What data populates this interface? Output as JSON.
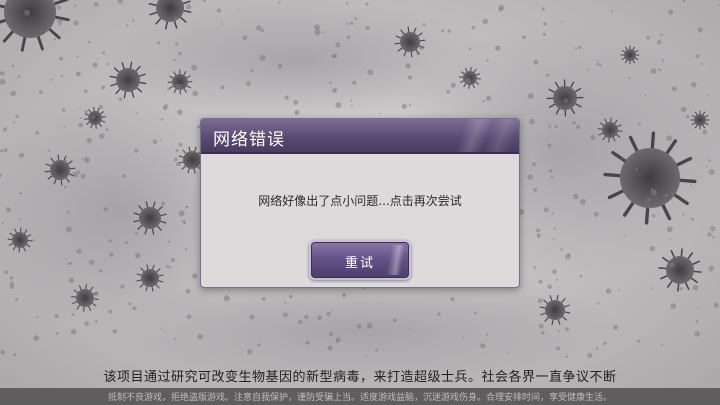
{
  "dialog": {
    "title": "网络错误",
    "message": "网络好像出了点小问题...点击再次尝试",
    "retry_label": "重试"
  },
  "tip": "该项目通过研究可改变生物基因的新型病毒，来打造超级士兵。社会各界一直争议不断",
  "footer": "抵制不良游戏，拒绝盗版游戏。注意自我保护，谨防受骗上当。适度游戏益脑，沉迷游戏伤身。合理安排时间，享受健康生活。",
  "colors": {
    "header_purple": "#5a4b72",
    "dialog_bg": "#dcdadb",
    "footer_bg": "#5e5e5e"
  }
}
